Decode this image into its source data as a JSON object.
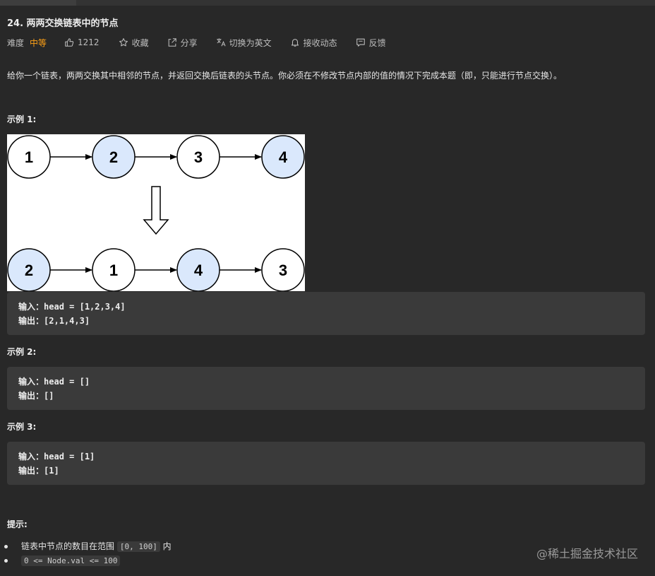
{
  "problem": {
    "title": "24. 两两交换链表中的节点",
    "difficulty_label": "难度",
    "difficulty_value": "中等",
    "likes": "1212",
    "favorite_label": "收藏",
    "share_label": "分享",
    "switch_lang_label": "切换为英文",
    "subscribe_label": "接收动态",
    "feedback_label": "反馈",
    "description": "给你一个链表，两两交换其中相邻的节点，并返回交换后链表的头节点。你必须在不修改节点内部的值的情况下完成本题（即，只能进行节点交换）。"
  },
  "examples": [
    {
      "title": "示例 1:",
      "input_label": "输入：",
      "input_value": "head = [1,2,3,4]",
      "output_label": "输出：",
      "output_value": "[2,1,4,3]"
    },
    {
      "title": "示例 2:",
      "input_label": "输入：",
      "input_value": "head = []",
      "output_label": "输出：",
      "output_value": "[]"
    },
    {
      "title": "示例 3:",
      "input_label": "输入：",
      "input_value": "head = [1]",
      "output_label": "输出：",
      "output_value": "[1]"
    }
  ],
  "diagram": {
    "before": [
      "1",
      "2",
      "3",
      "4"
    ],
    "after": [
      "2",
      "1",
      "4",
      "3"
    ],
    "highlight_color": "#dae8fc"
  },
  "hints": {
    "title": "提示:",
    "item1_text": "链表中节点的数目在范围",
    "item1_code": "[0, 100]",
    "item1_suffix": "内",
    "item2_code": "0 <= Node.val <= 100"
  },
  "watermark": "@稀土掘金技术社区",
  "colors": {
    "background": "#282828",
    "accent_difficulty": "#ffa116",
    "code_bg": "#3a3a3a"
  }
}
